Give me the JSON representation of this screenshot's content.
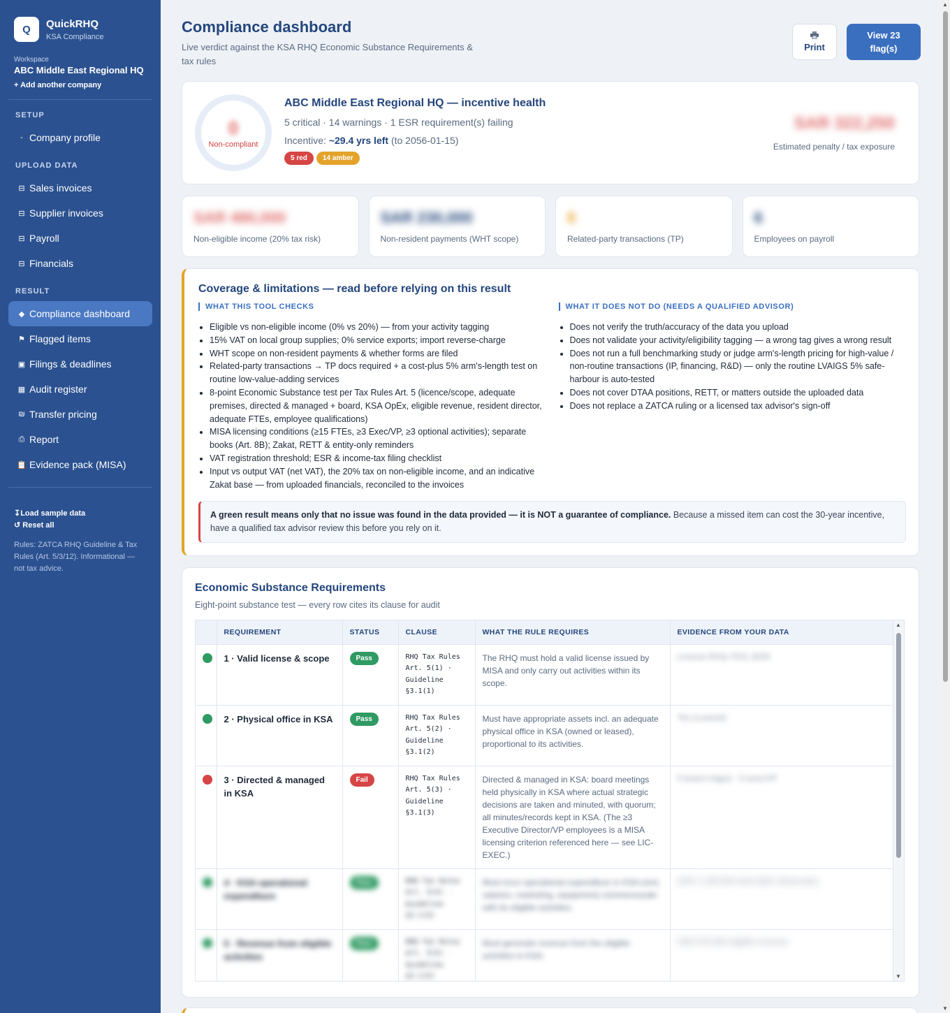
{
  "brand": {
    "logo": "Q",
    "title": "QuickRHQ",
    "subtitle": "KSA Compliance"
  },
  "workspace": {
    "label": "Workspace",
    "name": "ABC Middle East Regional HQ",
    "add": "+ Add another company"
  },
  "sidebar": {
    "setup_label": "SETUP",
    "setup_items": [
      {
        "icon": "dash-icon",
        "glyph": "-",
        "label": "Company profile"
      }
    ],
    "upload_label": "UPLOAD DATA",
    "upload_items": [
      {
        "icon": "table-icon",
        "glyph": "⊟",
        "label": "Sales invoices"
      },
      {
        "icon": "table-icon",
        "glyph": "⊟",
        "label": "Supplier invoices"
      },
      {
        "icon": "table-icon",
        "glyph": "⊟",
        "label": "Payroll"
      },
      {
        "icon": "table-icon",
        "glyph": "⊟",
        "label": "Financials"
      }
    ],
    "result_label": "RESULT",
    "result_items": [
      {
        "icon": "diamond-icon",
        "glyph": "◆",
        "label": "Compliance dashboard",
        "active": true
      },
      {
        "icon": "flag-icon",
        "glyph": "⚑",
        "label": "Flagged items"
      },
      {
        "icon": "calendar-icon",
        "glyph": "▣",
        "label": "Filings & deadlines"
      },
      {
        "icon": "grid-icon",
        "glyph": "▦",
        "label": "Audit register"
      },
      {
        "icon": "currency-icon",
        "glyph": "₪",
        "label": "Transfer pricing"
      },
      {
        "icon": "printer-icon",
        "glyph": "⎙",
        "label": "Report"
      },
      {
        "icon": "clipboard-icon",
        "glyph": "📋",
        "label": "Evidence pack (MISA)"
      }
    ],
    "load_sample": "↧Load sample data",
    "reset": "↺ Reset all",
    "note": "Rules: ZATCA RHQ Guideline & Tax Rules (Art. 5/3/12). Informational — not tax advice."
  },
  "header": {
    "title": "Compliance dashboard",
    "subtitle": "Live verdict against the KSA RHQ Economic Substance Requirements & tax rules",
    "print_label": "Print",
    "print_icon": "printer-icon",
    "flags_button": "View 23 flag(s)"
  },
  "health": {
    "score": "0",
    "status": "Non-compliant",
    "title": "ABC Middle East Regional HQ — incentive health",
    "summary": "5 critical · 14 warnings · 1 ESR requirement(s) failing",
    "incentive_prefix": "Incentive:",
    "incentive_years": "~29.4 yrs left",
    "incentive_suffix": "(to 2056-01-15)",
    "pill_red": "5 red",
    "pill_amber": "14 amber",
    "exposure_value": "SAR 322,250",
    "exposure_label": "Estimated penalty / tax exposure"
  },
  "kpis": [
    {
      "value": "SAR 480,000",
      "label": "Non-eligible income (20% tax risk)",
      "color": "#e06a6a"
    },
    {
      "value": "SAR 230,000",
      "label": "Non-resident payments (WHT scope)",
      "color": "#24467c"
    },
    {
      "value": "6",
      "label": "Related-party transactions (TP)",
      "color": "#e3a32a"
    },
    {
      "value": "6",
      "label": "Employees on payroll",
      "color": "#24467c"
    }
  ],
  "coverage": {
    "title": "Coverage & limitations — read before relying on this result",
    "checks_head": "WHAT THIS TOOL CHECKS",
    "checks": [
      "Eligible vs non-eligible income (0% vs 20%) — from your activity tagging",
      "15% VAT on local group supplies; 0% service exports; import reverse-charge",
      "WHT scope on non-resident payments & whether forms are filed",
      "Related-party transactions → TP docs required + a cost-plus 5% arm's-length test on routine low-value-adding services",
      "8-point Economic Substance test per Tax Rules Art. 5 (licence/scope, adequate premises, directed & managed + board, KSA OpEx, eligible revenue, resident director, adequate FTEs, employee qualifications)",
      "MISA licensing conditions (≥15 FTEs, ≥3 Exec/VP, ≥3 optional activities); separate books (Art. 8B); Zakat, RETT & entity-only reminders",
      "VAT registration threshold; ESR & income-tax filing checklist",
      "Input vs output VAT (net VAT), the 20% tax on non-eligible income, and an indicative Zakat base — from uploaded financials, reconciled to the invoices"
    ],
    "not_head": "WHAT IT DOES NOT DO (NEEDS A QUALIFIED ADVISOR)",
    "not_items": [
      "Does not verify the truth/accuracy of the data you upload",
      "Does not validate your activity/eligibility tagging — a wrong tag gives a wrong result",
      "Does not run a full benchmarking study or judge arm's-length pricing for high-value / non-routine transactions (IP, financing, R&D) — only the routine LVAIGS 5% safe-harbour is auto-tested",
      "Does not cover DTAA positions, RETT, or matters outside the uploaded data",
      "Does not replace a ZATCA ruling or a licensed tax advisor's sign-off"
    ],
    "note_bold": "A green result means only that no issue was found in the data provided — it is NOT a guarantee of compliance.",
    "note_rest": " Because a missed item can cost the 30-year incentive, have a qualified tax advisor review this before you rely on it."
  },
  "esr": {
    "title": "Economic Substance Requirements",
    "subtitle": "Eight-point substance test — every row cites its clause for audit",
    "columns": [
      "",
      "REQUIREMENT",
      "STATUS",
      "CLAUSE",
      "WHAT THE RULE REQUIRES",
      "EVIDENCE FROM YOUR DATA"
    ],
    "rows": [
      {
        "status": "pass",
        "requirement": "1 · Valid license & scope",
        "badge": "Pass",
        "clause": "RHQ Tax Rules Art. 5(1) · Guideline §3.1(1)",
        "rule": "The RHQ must hold a valid license issued by MISA and only carry out activities within its scope.",
        "evidence": "License RHQ-7531-3030",
        "blur": false
      },
      {
        "status": "pass",
        "requirement": "2 · Physical office in KSA",
        "badge": "Pass",
        "clause": "RHQ Tax Rules Art. 5(2) · Guideline §3.1(2)",
        "rule": "Must have appropriate assets incl. an adequate physical office in KSA (owned or leased), proportional to its activities.",
        "evidence": "Yes (Leased)",
        "blur": false
      },
      {
        "status": "fail",
        "requirement": "3 · Directed & managed in KSA",
        "badge": "Fail",
        "clause": "RHQ Tax Rules Art. 5(3) · Guideline §3.1(3)",
        "rule": "Directed & managed in KSA: board meetings held physically in KSA where actual strategic decisions are taken and minuted, with quorum; all minutes/records kept in KSA. (The ≥3 Executive Director/VP employees is a MISA licensing criterion referenced here — see LIC-EXEC.)",
        "evidence": "0 board mtg(s) · 0 exec/VP",
        "blur": false
      },
      {
        "status": "pass",
        "requirement": "4 · KSA operational expenditure",
        "badge": "Pass",
        "clause": "RHQ Tax Rules Art. 5(4) · Guideline §3.1(4)",
        "rule": "Must incur operational expenditure in KSA (rent, salaries, marketing, equipment) commensurate with its eligible activities.",
        "evidence": "SAR 1,180,000 total OpEx (financials)",
        "blur": true
      },
      {
        "status": "pass",
        "requirement": "5 · Revenue from eligible activities",
        "badge": "Pass",
        "clause": "RHQ Tax Rules Art. 5(5) · Guideline §3.1(5)",
        "rule": "Must generate revenue from the eligible activities in KSA.",
        "evidence": "SAR 970,000 eligible revenue",
        "blur": true
      }
    ]
  }
}
